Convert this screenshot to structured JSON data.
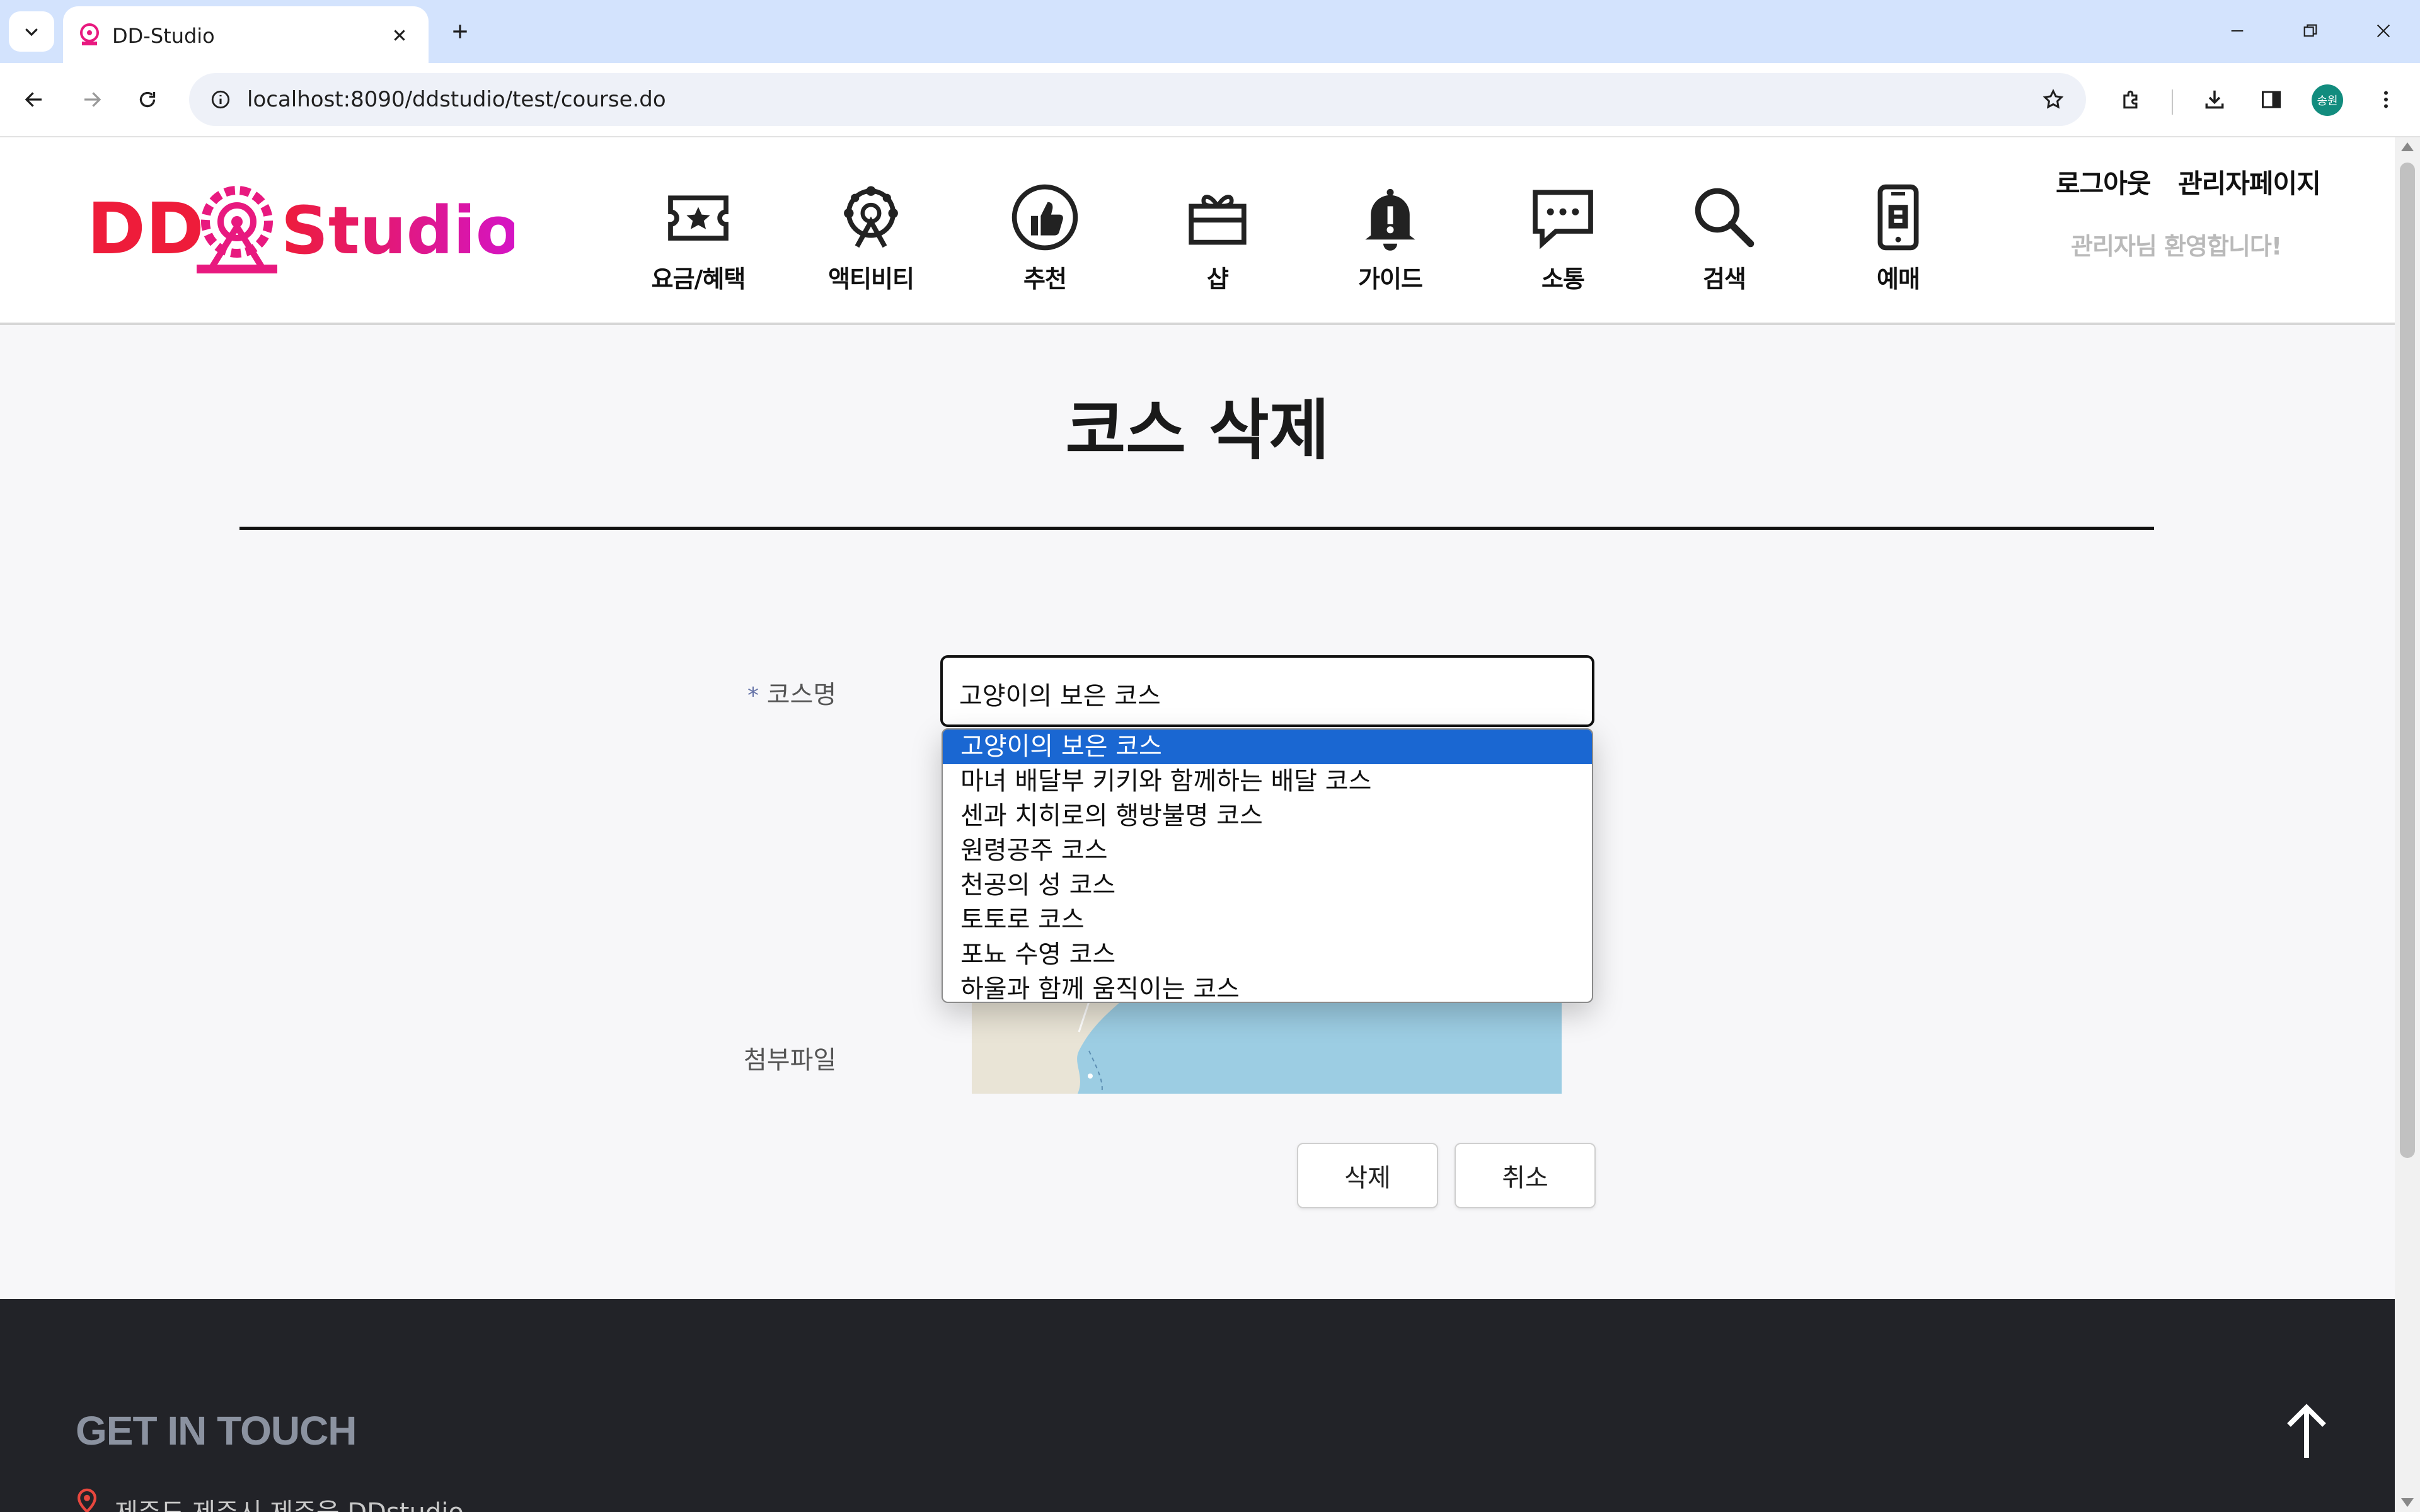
{
  "browser": {
    "tab_title": "DD-Studio",
    "url": "localhost:8090/ddstudio/test/course.do",
    "profile_label": "송원"
  },
  "header": {
    "logo_text_left": "DD",
    "logo_text_right": "Studio",
    "nav": [
      {
        "label": "요금/혜택",
        "icon": "ticket-star-icon"
      },
      {
        "label": "액티비티",
        "icon": "ferris-wheel-icon"
      },
      {
        "label": "추천",
        "icon": "thumbs-up-icon"
      },
      {
        "label": "샵",
        "icon": "gift-box-icon"
      },
      {
        "label": "가이드",
        "icon": "bell-alert-icon"
      },
      {
        "label": "소통",
        "icon": "chat-bubble-icon"
      },
      {
        "label": "검색",
        "icon": "search-icon"
      },
      {
        "label": "예매",
        "icon": "mobile-ticket-icon"
      }
    ],
    "logout": "로그아웃",
    "admin_page": "관리자페이지",
    "welcome": "관리자님 환영합니다!"
  },
  "page": {
    "title": "코스 삭제",
    "course_label_required": "*",
    "course_label": "코스명",
    "attachment_label": "첨부파일",
    "selected_course": "고양이의 보은 코스",
    "options": [
      "고양이의 보은 코스",
      "마녀 배달부 키키와 함께하는 배달 코스",
      "센과 치히로의 행방불명 코스",
      "원령공주 코스",
      "천공의 성 코스",
      "토토로 코스",
      "포뇨 수영 코스",
      "하울과 함께 움직이는 코스"
    ],
    "delete_button": "삭제",
    "cancel_button": "취소"
  },
  "footer": {
    "title": "GET IN TOUCH",
    "address": "제주도 제주시 제주읍 DDstudio"
  },
  "colors": {
    "tabstrip": "#d3e3fd",
    "logo_red": "#ee1c3a",
    "logo_magenta": "#d414c8",
    "select_highlight": "#1a67d2",
    "footer_bg": "#222328"
  }
}
